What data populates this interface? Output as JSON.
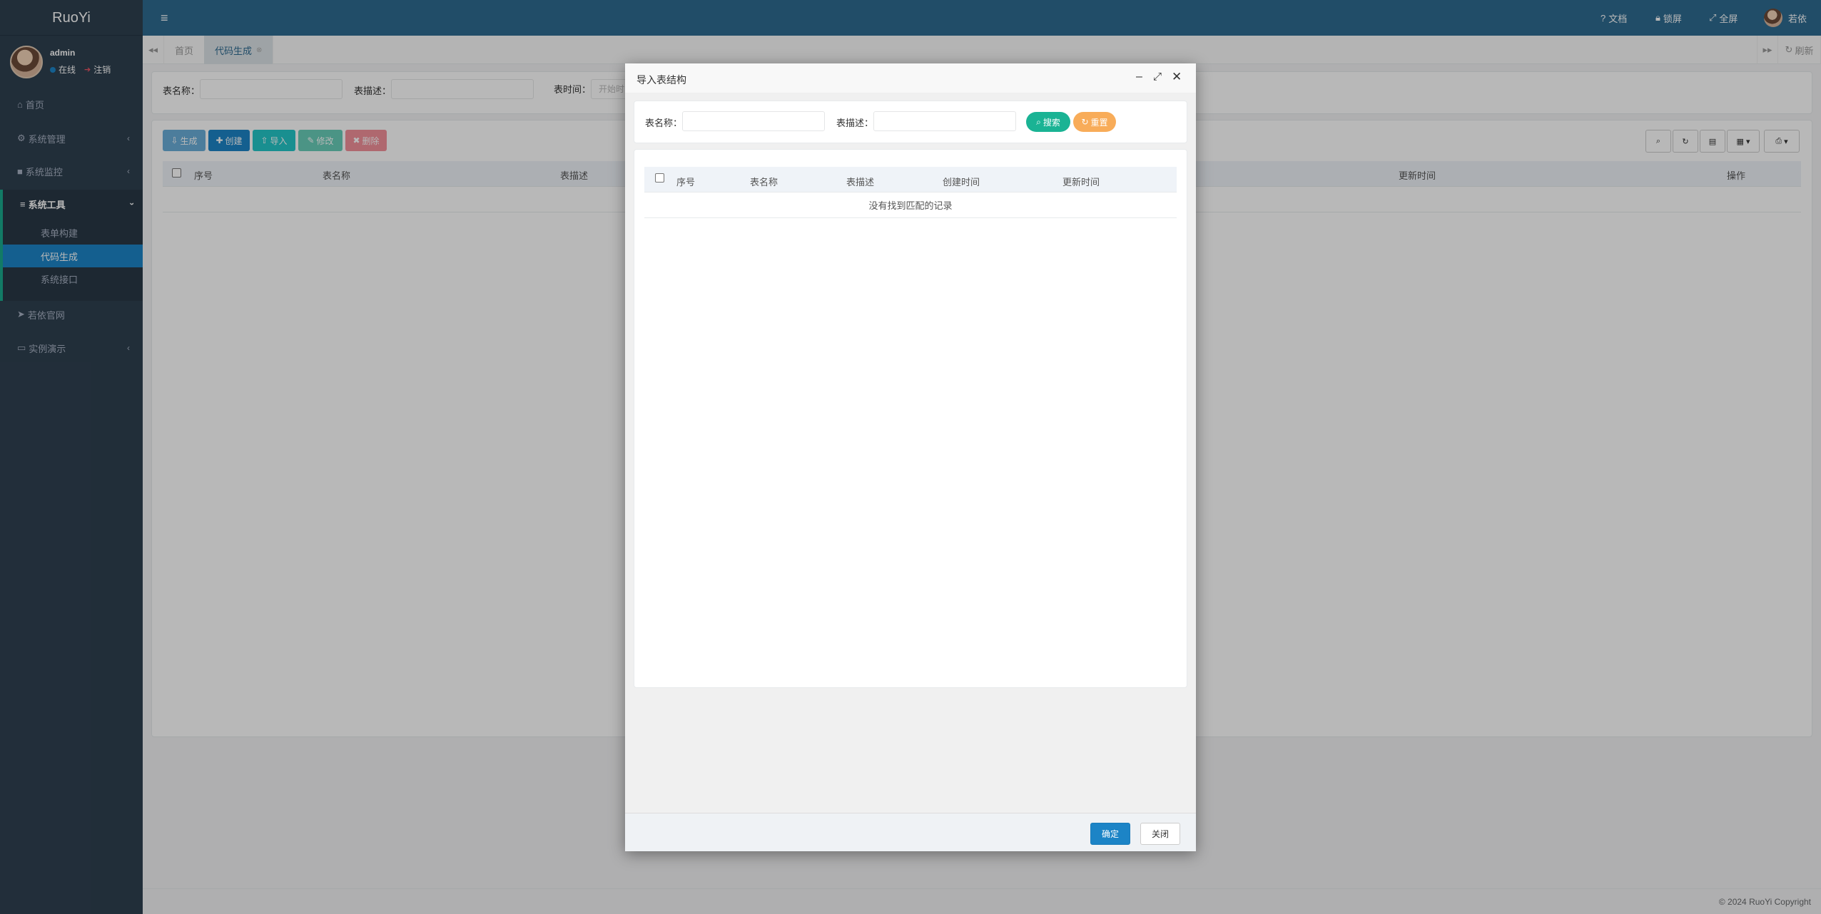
{
  "brand": "RuoYi",
  "user": {
    "name": "admin",
    "online": "在线",
    "logout": "注销",
    "online_color": "#1c84c6",
    "logout_color": "#ed5565"
  },
  "sidebar": {
    "home": "首页",
    "system_mgmt": "系统管理",
    "system_monitor": "系统监控",
    "system_tools": "系统工具",
    "sub_items": [
      "表单构建",
      "代码生成",
      "系统接口"
    ],
    "ruoyi_site": "若依官网",
    "demo": "实例演示"
  },
  "topbar": {
    "docs": "文档",
    "lock": "锁屏",
    "fullscreen": "全屏",
    "user": "若依"
  },
  "tabs": {
    "home": "首页",
    "codegen": "代码生成",
    "refresh": "刷新"
  },
  "search": {
    "table_name_label": "表名称：",
    "table_desc_label": "表描述：",
    "table_time_label": "表时间：",
    "time_placeholder": "开始时间"
  },
  "toolbar": {
    "generate": "生成",
    "create": "创建",
    "import": "导入",
    "edit": "修改",
    "delete": "删除"
  },
  "table": {
    "columns": [
      "序号",
      "表名称",
      "表描述",
      "更新时间",
      "操作"
    ]
  },
  "footer": {
    "copyright": "© 2024 RuoYi Copyright"
  },
  "modal": {
    "title": "导入表结构",
    "table_name_label": "表名称：",
    "table_desc_label": "表描述：",
    "search_btn": "搜索",
    "reset_btn": "重置",
    "columns": [
      "序号",
      "表名称",
      "表描述",
      "创建时间",
      "更新时间"
    ],
    "empty_text": "没有找到匹配的记录",
    "confirm_btn": "确定",
    "close_btn": "关闭"
  },
  "colors": {
    "sidebar": "#2f4050",
    "topbar": "#2f6b91",
    "primary": "#1c84c6",
    "success": "#1ab394",
    "warning": "#f8ac59",
    "danger": "#ed5565"
  }
}
